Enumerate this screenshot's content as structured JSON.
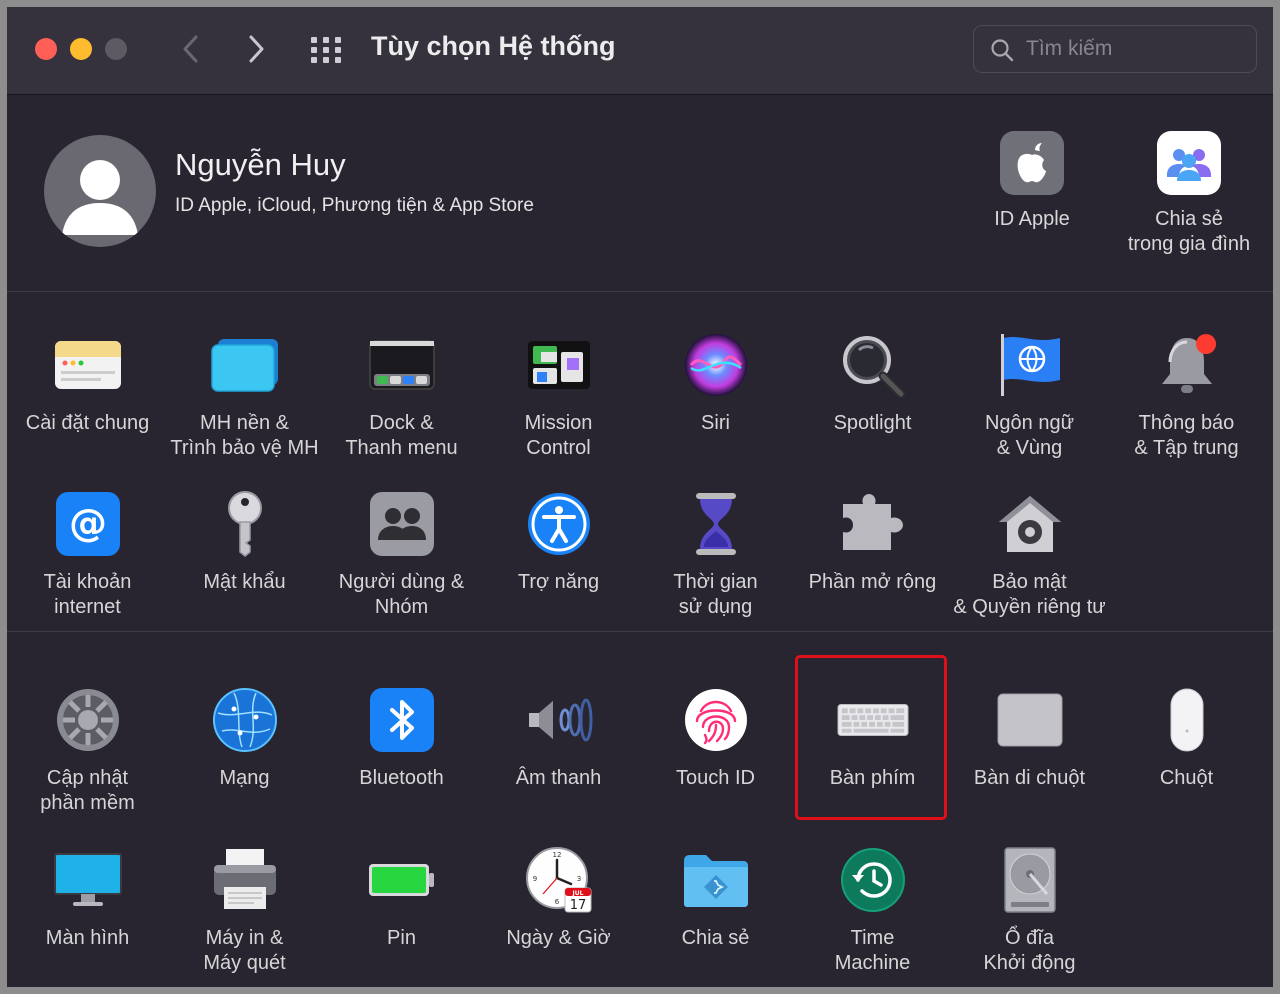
{
  "window": {
    "title": "Tùy chọn Hệ thống"
  },
  "search": {
    "placeholder": "Tìm kiếm"
  },
  "account": {
    "name": "Nguyễn Huy",
    "subtitle": "ID Apple, iCloud, Phương tiện & App Store",
    "items": [
      {
        "label": "ID Apple",
        "icon": "apple-logo-icon"
      },
      {
        "label": "Chia sẻ\ntrong gia đình",
        "icon": "family-sharing-icon"
      }
    ]
  },
  "panes": {
    "row1": [
      {
        "label": "Cài đặt chung",
        "icon": "general-icon"
      },
      {
        "label": "MH nền &\nTrình bảo vệ MH",
        "icon": "desktop-screensaver-icon"
      },
      {
        "label": "Dock &\nThanh menu",
        "icon": "dock-icon"
      },
      {
        "label": "Mission\nControl",
        "icon": "mission-control-icon"
      },
      {
        "label": "Siri",
        "icon": "siri-icon"
      },
      {
        "label": "Spotlight",
        "icon": "spotlight-icon"
      },
      {
        "label": "Ngôn ngữ\n& Vùng",
        "icon": "language-region-icon"
      },
      {
        "label": "Thông báo\n& Tập trung",
        "icon": "notifications-icon"
      }
    ],
    "row2": [
      {
        "label": "Tài khoản\ninternet",
        "icon": "internet-accounts-icon"
      },
      {
        "label": "Mật khẩu",
        "icon": "key-icon"
      },
      {
        "label": "Người dùng &\nNhóm",
        "icon": "users-groups-icon"
      },
      {
        "label": "Trợ năng",
        "icon": "accessibility-icon"
      },
      {
        "label": "Thời gian\nsử dụng",
        "icon": "screen-time-icon"
      },
      {
        "label": "Phần mở rộng",
        "icon": "extensions-icon"
      },
      {
        "label": "Bảo mật\n& Quyền riêng tư",
        "icon": "security-privacy-icon"
      }
    ],
    "row3": [
      {
        "label": "Cập nhật\nphần mềm",
        "icon": "software-update-icon"
      },
      {
        "label": "Mạng",
        "icon": "network-icon"
      },
      {
        "label": "Bluetooth",
        "icon": "bluetooth-icon"
      },
      {
        "label": "Âm thanh",
        "icon": "sound-icon"
      },
      {
        "label": "Touch ID",
        "icon": "touch-id-icon"
      },
      {
        "label": "Bàn phím",
        "icon": "keyboard-icon"
      },
      {
        "label": "Bàn di chuột",
        "icon": "trackpad-icon"
      },
      {
        "label": "Chuột",
        "icon": "mouse-icon"
      }
    ],
    "row4": [
      {
        "label": "Màn hình",
        "icon": "displays-icon"
      },
      {
        "label": "Máy in &\nMáy quét",
        "icon": "printer-icon"
      },
      {
        "label": "Pin",
        "icon": "battery-icon"
      },
      {
        "label": "Ngày & Giờ",
        "icon": "date-time-icon"
      },
      {
        "label": "Chia sẻ",
        "icon": "sharing-folder-icon"
      },
      {
        "label": "Time\nMachine",
        "icon": "time-machine-icon"
      },
      {
        "label": "Ổ đĩa\nKhởi động",
        "icon": "startup-disk-icon"
      }
    ]
  },
  "calendar_badge": {
    "month": "JUL",
    "day": "17"
  },
  "colors": {
    "window_bg": "#282430",
    "titlebar_bg": "#35313d",
    "highlight": "#e0101a",
    "accent_blue": "#1a82f7"
  }
}
